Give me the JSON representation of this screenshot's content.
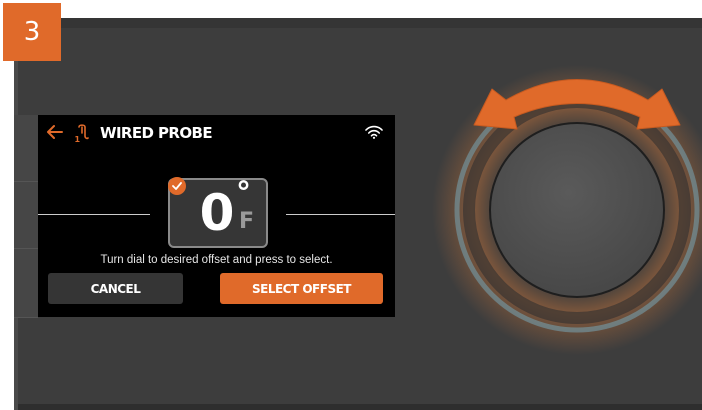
{
  "step": {
    "number": "3"
  },
  "screen": {
    "title": "WIRED PROBE",
    "probe_badge": "1",
    "temperature": {
      "value": "0",
      "degree": "°",
      "unit": "F",
      "selected": true
    },
    "instruction": "Turn dial to desired offset and press to select.",
    "buttons": {
      "cancel": "CANCEL",
      "select": "SELECT OFFSET"
    }
  },
  "icons": {
    "back": "back-arrow-icon",
    "probe": "probe-icon",
    "wifi": "wifi-icon",
    "check": "check-icon",
    "rotate": "rotate-arrows-icon"
  },
  "colors": {
    "accent": "#e06a2a",
    "screen_bg": "#000000",
    "panel_bg": "#3d3d3d",
    "dial_glow": "#7ab8cf"
  }
}
